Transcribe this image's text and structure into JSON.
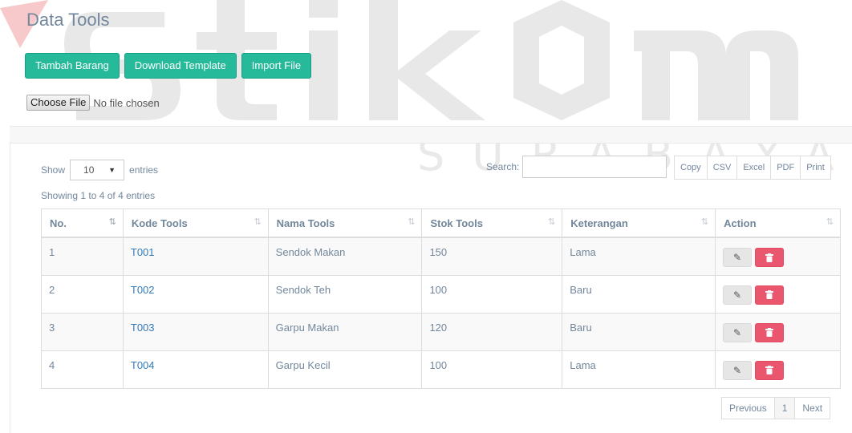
{
  "page": {
    "title": "Data Tools"
  },
  "watermark": {
    "brand": "stikom",
    "sub": "SURABAYA"
  },
  "actions": {
    "add_label": "Tambah Barang",
    "download_label": "Download Template",
    "import_label": "Import File"
  },
  "file_input": {
    "button_label": "Choose File",
    "status": "No file chosen"
  },
  "table_controls": {
    "show_label": "Show",
    "page_size": "10",
    "entries_label": "entries",
    "search_label": "Search:",
    "search_value": "",
    "export": [
      "Copy",
      "CSV",
      "Excel",
      "PDF",
      "Print"
    ]
  },
  "info": "Showing 1 to 4 of 4 entries",
  "table": {
    "headers": [
      "No.",
      "Kode Tools",
      "Nama Tools",
      "Stok Tools",
      "Keterangan",
      "Action"
    ],
    "rows": [
      {
        "no": "1",
        "kode": "T001",
        "nama": "Sendok Makan",
        "stok": "150",
        "ket": "Lama"
      },
      {
        "no": "2",
        "kode": "T002",
        "nama": "Sendok Teh",
        "stok": "100",
        "ket": "Baru"
      },
      {
        "no": "3",
        "kode": "T003",
        "nama": "Garpu Makan",
        "stok": "120",
        "ket": "Baru"
      },
      {
        "no": "4",
        "kode": "T004",
        "nama": "Garpu Kecil",
        "stok": "100",
        "ket": "Lama"
      }
    ]
  },
  "pagination": {
    "prev": "Previous",
    "current": "1",
    "next": "Next"
  },
  "colors": {
    "accent": "#26b99a",
    "danger": "#e9566d",
    "link": "#337ab7",
    "watermark_red": "#d9161c"
  }
}
